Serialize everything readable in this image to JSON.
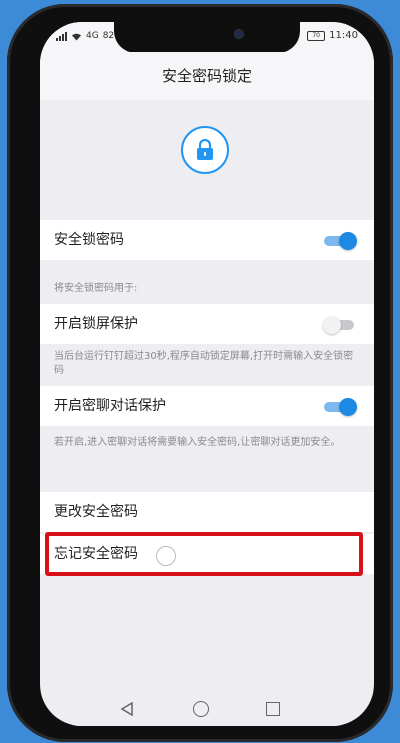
{
  "status": {
    "carrier": "4G",
    "speed": "82",
    "battery": "70",
    "time": "11:40"
  },
  "header": {
    "title": "安全密码锁定"
  },
  "rows": {
    "safety_lock": {
      "label": "安全锁密码",
      "enabled": true
    },
    "section_hint": "将安全锁密码用于:",
    "lockscreen": {
      "label": "开启锁屏保护",
      "enabled": false
    },
    "lockscreen_hint": "当后台运行钉钉超过30秒,程序自动锁定屏幕,打开时需输入安全锁密码",
    "secret_chat": {
      "label": "开启密聊对话保护",
      "enabled": true
    },
    "secret_chat_hint": "若开启,进入密聊对话将需要输入安全密码,让密聊对话更加安全。",
    "change_password": {
      "label": "更改安全密码"
    },
    "forgot_password": {
      "label": "忘记安全密码"
    }
  },
  "colors": {
    "accent": "#1e88e5",
    "highlight": "#d8101a"
  }
}
